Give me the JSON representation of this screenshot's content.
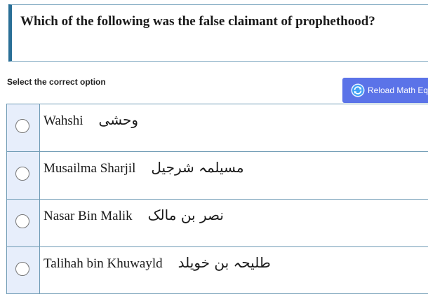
{
  "question": {
    "text": "Which of the following was the false claimant of prophethood?"
  },
  "instructions": {
    "select_label": "Select the correct option"
  },
  "reload_button": {
    "label": "Reload Math Eq",
    "icon": "refresh-icon",
    "color": "#5b73e8"
  },
  "options": [
    {
      "en": "Wahshi",
      "ar": "وحشی"
    },
    {
      "en": "Musailma Sharjil",
      "ar": "مسیلمہ شرجیل"
    },
    {
      "en": "Nasar Bin Malik",
      "ar": "نصر بن مالک"
    },
    {
      "en": "Talihah bin Khuwayld",
      "ar": "طلیحہ بن خویلد"
    }
  ],
  "colors": {
    "accent_border": "#2a6f97",
    "radio_cell_bg": "#e7eefb",
    "row_border": "#6f9bb5"
  }
}
